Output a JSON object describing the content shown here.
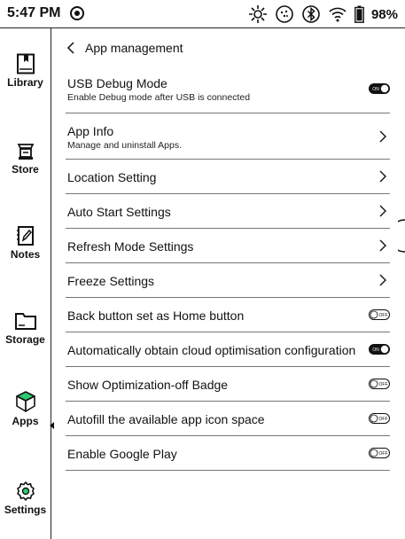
{
  "status_bar": {
    "time": "5:47 PM",
    "battery": "98%"
  },
  "sidebar": {
    "items": [
      {
        "label": "Library",
        "icon": "book-icon"
      },
      {
        "label": "Store",
        "icon": "store-icon"
      },
      {
        "label": "Notes",
        "icon": "notes-icon"
      },
      {
        "label": "Storage",
        "icon": "folder-icon"
      },
      {
        "label": "Apps",
        "icon": "cube-icon",
        "selected": true
      },
      {
        "label": "Settings",
        "icon": "gear-icon"
      }
    ]
  },
  "page": {
    "title": "App management"
  },
  "settings": [
    {
      "title": "USB Debug Mode",
      "subtitle": "Enable Debug mode after USB is connected",
      "control": "toggle",
      "on": true,
      "toggle_text": "ON"
    },
    {
      "title": "App Info",
      "subtitle": "Manage and uninstall Apps.",
      "control": "chevron"
    },
    {
      "title": "Location Setting",
      "control": "chevron"
    },
    {
      "title": "Auto Start Settings",
      "control": "chevron"
    },
    {
      "title": "Refresh Mode Settings",
      "control": "chevron"
    },
    {
      "title": "Freeze Settings",
      "control": "chevron"
    },
    {
      "title": "Back button set as Home button",
      "control": "toggle",
      "on": false,
      "toggle_text": "OFF"
    },
    {
      "title": "Automatically obtain cloud optimisation configuration",
      "control": "toggle",
      "on": true,
      "toggle_text": "ON"
    },
    {
      "title": "Show Optimization-off Badge",
      "control": "toggle",
      "on": false,
      "toggle_text": "OFF"
    },
    {
      "title": "Autofill the available app icon space",
      "control": "toggle",
      "on": false,
      "toggle_text": "OFF"
    },
    {
      "title": "Enable Google Play",
      "control": "toggle",
      "on": false,
      "toggle_text": "OFF"
    }
  ]
}
